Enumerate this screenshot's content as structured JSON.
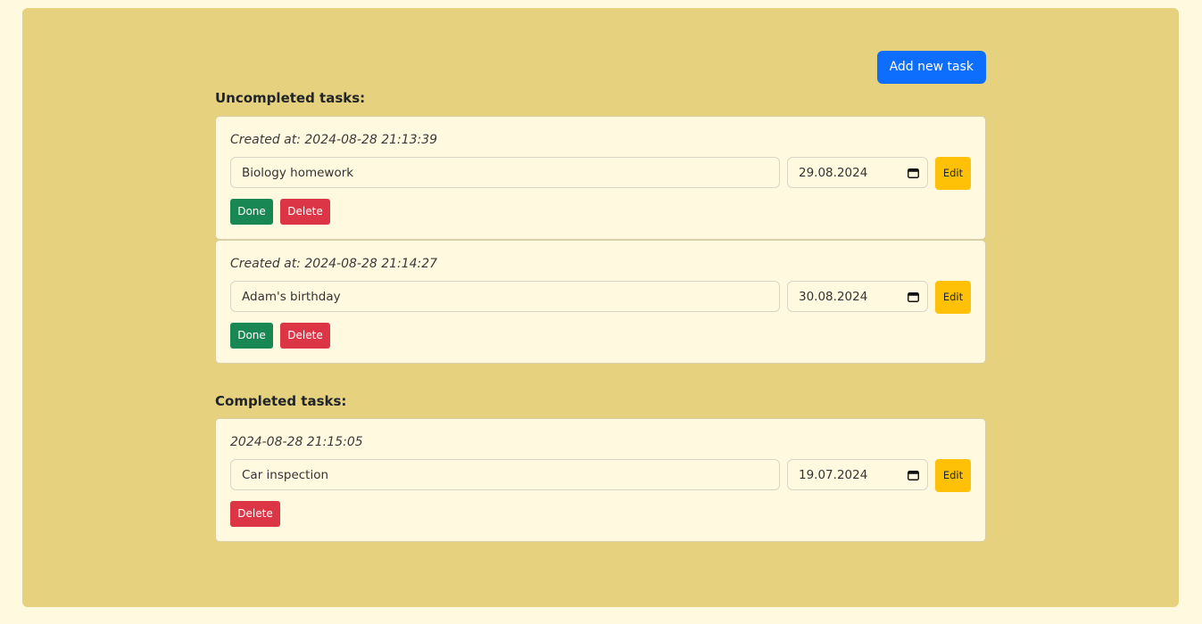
{
  "toolbar": {
    "add_label": "Add new task"
  },
  "uncompleted": {
    "heading": "Uncompleted tasks:",
    "tasks": [
      {
        "created": "Created at: 2024-08-28 21:13:39",
        "title": "Biology homework",
        "date": "29.08.2024",
        "edit_label": "Edit",
        "done_label": "Done",
        "delete_label": "Delete"
      },
      {
        "created": "Created at: 2024-08-28 21:14:27",
        "title": "Adam's birthday",
        "date": "30.08.2024",
        "edit_label": "Edit",
        "done_label": "Done",
        "delete_label": "Delete"
      }
    ]
  },
  "completed": {
    "heading": "Completed tasks:",
    "tasks": [
      {
        "created": "2024-08-28 21:15:05",
        "title": "Car inspection",
        "date": "19.07.2024",
        "edit_label": "Edit",
        "delete_label": "Delete"
      }
    ]
  },
  "colors": {
    "page_bg": "#fff9df",
    "panel_bg": "#e5d17e",
    "primary": "#0d6efd",
    "success": "#198754",
    "danger": "#dc3545",
    "warning": "#ffc107"
  },
  "icons": {
    "date_picker": "calendar-icon"
  }
}
